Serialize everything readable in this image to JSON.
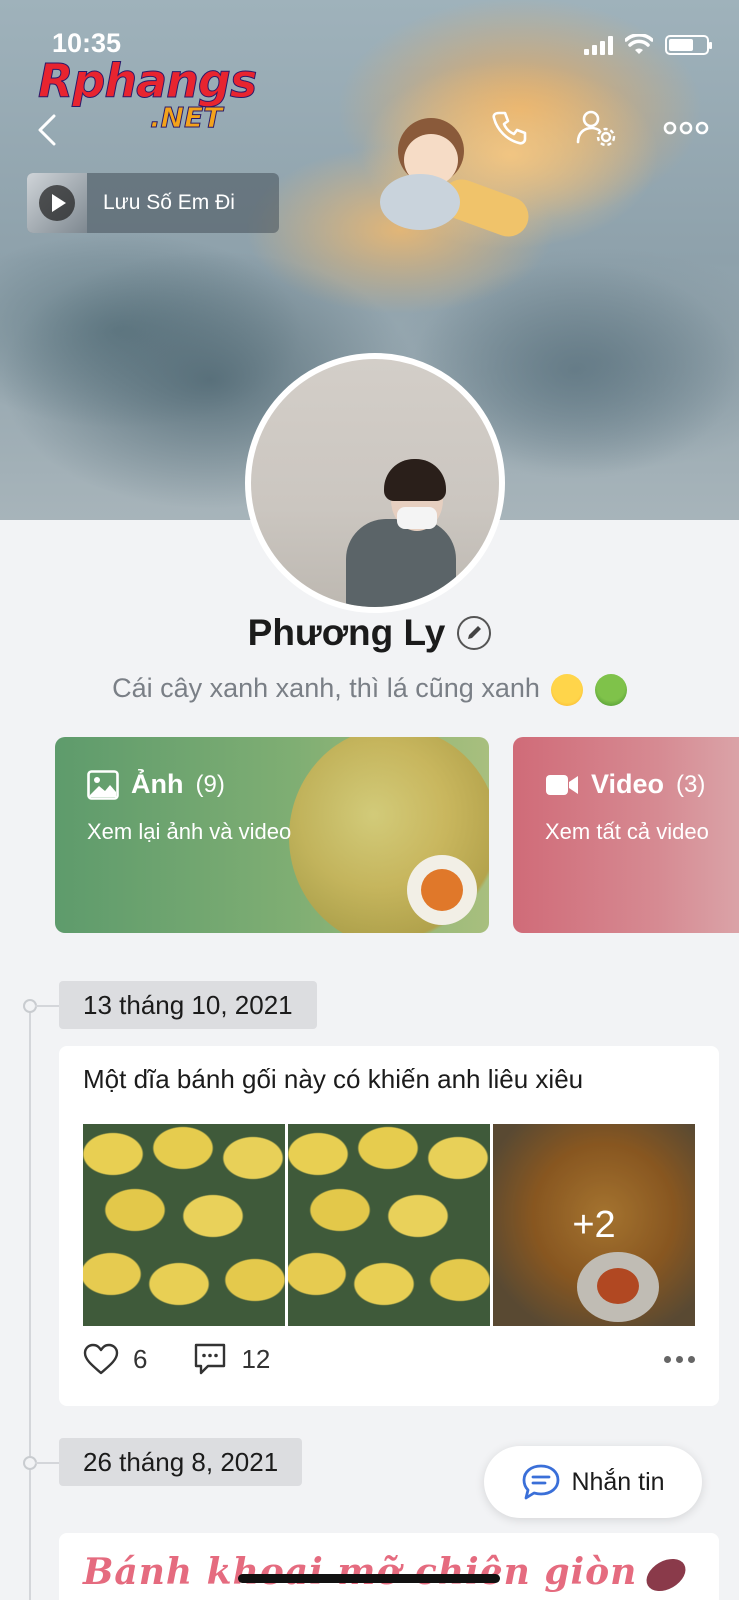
{
  "status_bar": {
    "time": "10:35"
  },
  "watermark": {
    "line1": "Rphangs",
    "line2": ".NET"
  },
  "music": {
    "title": "Lưu Số Em Đi"
  },
  "profile": {
    "name": "Phương Ly",
    "bio": "Cái cây xanh xanh, thì lá cũng xanh"
  },
  "media": {
    "photos": {
      "label": "Ảnh",
      "count": "(9)",
      "subtitle": "Xem lại ảnh và video"
    },
    "videos": {
      "label": "Video",
      "count": "(3)",
      "subtitle": "Xem tất cả video"
    }
  },
  "timeline": [
    {
      "date": "13 tháng 10, 2021",
      "text": "Một dĩa bánh gối này có khiến anh liêu xiêu",
      "extra_photos": "+2",
      "likes": "6",
      "comments": "12"
    },
    {
      "date": "26 tháng 8, 2021",
      "text": "Bánh khoai mỡ chiên giòn"
    }
  ],
  "message_button": {
    "label": "Nhắn tin"
  },
  "colors": {
    "photo_card": "#6fa56f",
    "video_card": "#d37480",
    "message_icon": "#3a6fd8"
  }
}
